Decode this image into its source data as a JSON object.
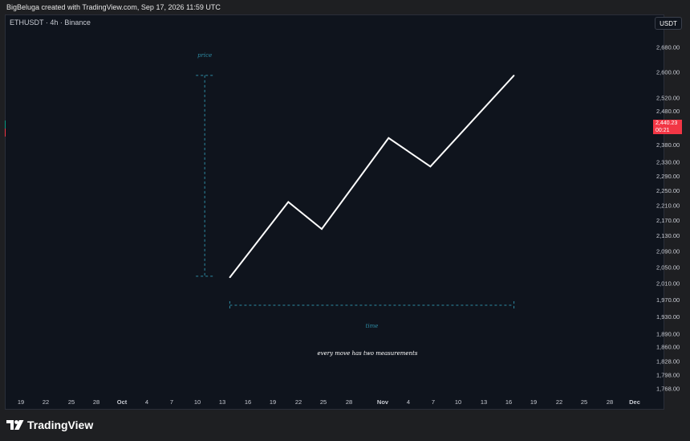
{
  "header": {
    "attribution": "BigBeluga created with TradingView.com, Sep 17, 2026 11:59 UTC"
  },
  "symbol": {
    "label": "ETHUSDT · 4h · Binance"
  },
  "currency": {
    "label": "USDT"
  },
  "last_price": {
    "value": "2,440.23",
    "countdown": "00:21"
  },
  "brand": {
    "name": "TradingView"
  },
  "colors": {
    "background": "#0f141d",
    "line": "#ffffff",
    "annotation": "#2e8ba3",
    "price_tag": "#f23645"
  },
  "chart_data": {
    "type": "line",
    "y_axis": {
      "scale": "log",
      "ticks": [
        2680,
        2600,
        2520,
        2480,
        2380,
        2330,
        2290,
        2250,
        2210,
        2170,
        2130,
        2090,
        2050,
        2010,
        1970,
        1930,
        1890,
        1860,
        1828,
        1798,
        1768
      ],
      "tick_labels": [
        "2,680.00",
        "2,600.00",
        "2,520.00",
        "2,480.00",
        "2,380.00",
        "2,330.00",
        "2,290.00",
        "2,250.00",
        "2,210.00",
        "2,170.00",
        "2,130.00",
        "2,090.00",
        "2,050.00",
        "2,010.00",
        "1,970.00",
        "1,930.00",
        "1,890.00",
        "1,860.00",
        "1,828.00",
        "1,798.00",
        "1,768.00"
      ]
    },
    "x_axis": {
      "tick_labels": [
        "19",
        "22",
        "25",
        "28",
        "Oct",
        "4",
        "7",
        "10",
        "13",
        "16",
        "19",
        "22",
        "25",
        "28",
        "Nov",
        "4",
        "7",
        "10",
        "13",
        "16",
        "19",
        "22",
        "25",
        "28",
        "Dec"
      ],
      "bold_labels": [
        "Oct",
        "Nov",
        "Dec"
      ]
    },
    "series": [
      {
        "x": [
          "2026-10-14",
          "2026-10-21",
          "2026-10-25",
          "2026-11-02",
          "2026-11-07",
          "2026-11-17"
        ],
        "y": [
          2025,
          2220,
          2148,
          2400,
          2318,
          2590
        ]
      }
    ],
    "annotations": [
      {
        "text": "price",
        "kind": "vertical-measure",
        "from": 2028,
        "to": 2590,
        "at_x": "2026-10-11"
      },
      {
        "text": "time",
        "kind": "horizontal-measure",
        "from": "2026-10-14",
        "to": "2026-11-17"
      },
      {
        "text": "every move has two measurements",
        "kind": "caption"
      }
    ],
    "grid": false
  }
}
